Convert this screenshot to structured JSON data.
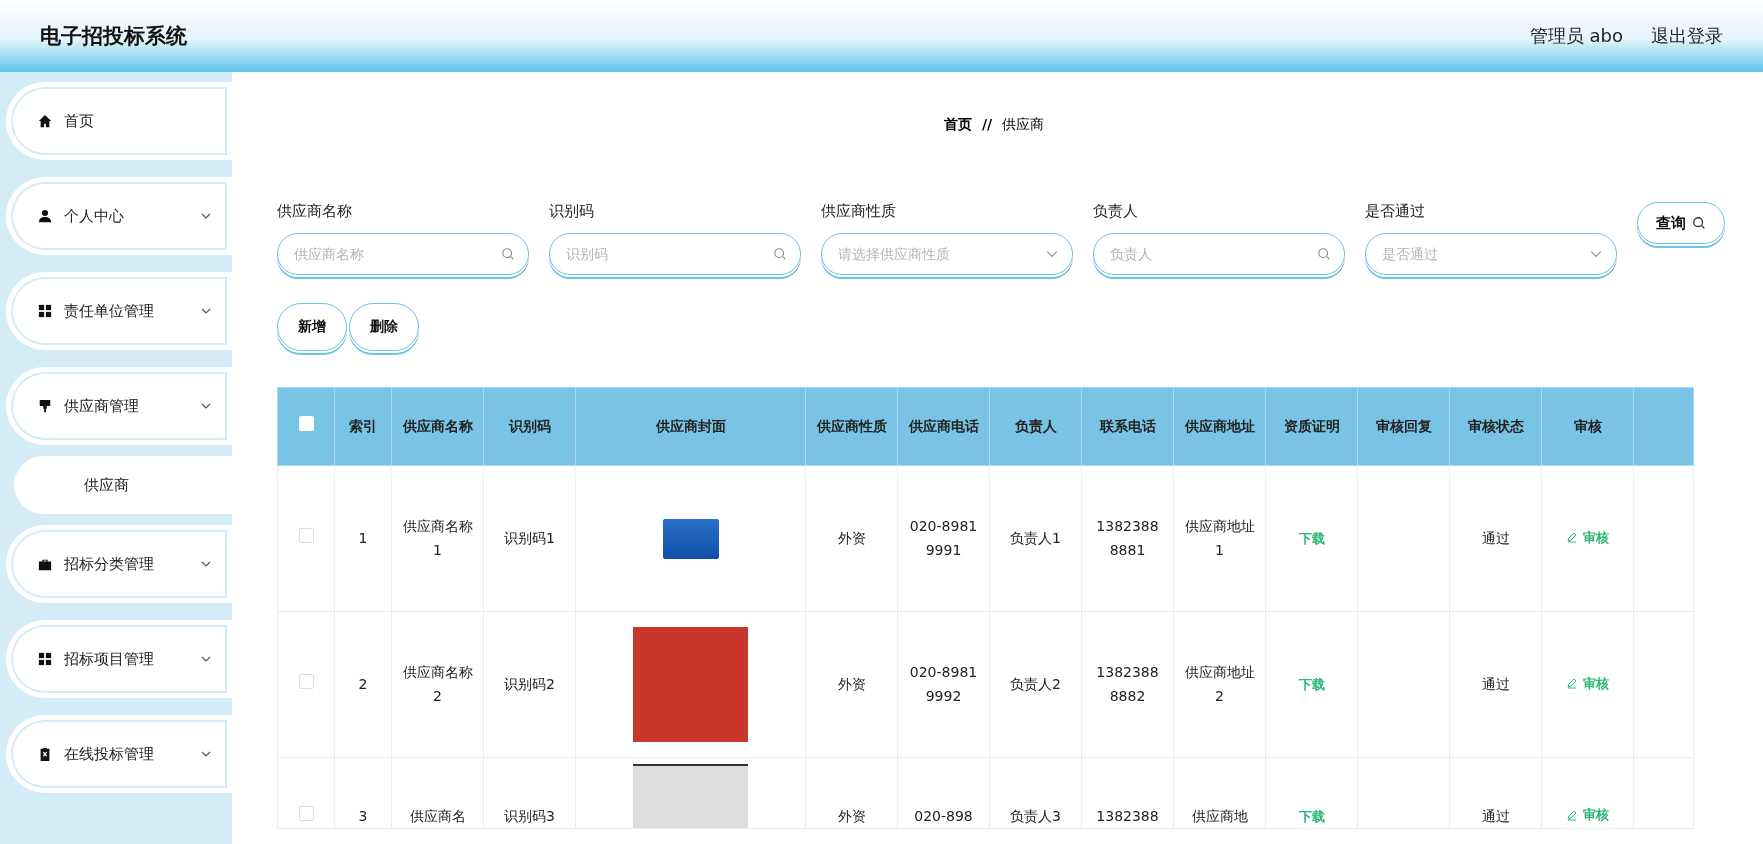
{
  "header": {
    "title": "电子招投标系统",
    "user": "管理员 abo",
    "logout": "退出登录"
  },
  "sidebar": {
    "items": [
      {
        "label": "首页",
        "kind": "link"
      },
      {
        "label": "个人中心",
        "kind": "group"
      },
      {
        "label": "责任单位管理",
        "kind": "group"
      },
      {
        "label": "供应商管理",
        "kind": "group",
        "children": [
          {
            "label": "供应商"
          }
        ]
      },
      {
        "label": "招标分类管理",
        "kind": "group"
      },
      {
        "label": "招标项目管理",
        "kind": "group"
      },
      {
        "label": "在线投标管理",
        "kind": "group"
      }
    ]
  },
  "breadcrumb": [
    "首页",
    "//",
    "供应商"
  ],
  "filters": [
    {
      "label": "供应商名称",
      "placeholder": "供应商名称",
      "kind": "search"
    },
    {
      "label": "识别码",
      "placeholder": "识别码",
      "kind": "search"
    },
    {
      "label": "供应商性质",
      "placeholder": "请选择供应商性质",
      "kind": "select"
    },
    {
      "label": "负责人",
      "placeholder": "负责人",
      "kind": "search"
    },
    {
      "label": "是否通过",
      "placeholder": "是否通过",
      "kind": "select"
    }
  ],
  "query_button": "查询",
  "actions": [
    "新增",
    "删除"
  ],
  "table": {
    "all_checked": false,
    "columns": [
      "索引",
      "供应商名称",
      "识别码",
      "供应商封面",
      "供应商性质",
      "供应商电话",
      "负责人",
      "联系电话",
      "供应商地址",
      "资质证明",
      "审核回复",
      "审核状态",
      "审核"
    ],
    "rows": [
      {
        "checked": false,
        "index": "1",
        "name": "供应商名称1",
        "code": "识别码1",
        "cover": {
          "kind": "logo"
        },
        "nature": "外资",
        "phone": "020-89819991",
        "person": "负责人1",
        "contact": "13823888881",
        "address": "供应商地址1",
        "qualification": "下载",
        "status": "通过",
        "action": "审核"
      },
      {
        "checked": false,
        "index": "2",
        "name": "供应商名称2",
        "code": "识别码2",
        "cover": {
          "kind": "photo"
        },
        "nature": "外资",
        "phone": "020-89819992",
        "person": "负责人2",
        "contact": "13823888882",
        "address": "供应商地址2",
        "qualification": "下载",
        "status": "通过",
        "action": "审核"
      },
      {
        "checked": false,
        "index": "3",
        "name": "供应商名",
        "code": "识别码3",
        "cover": {
          "kind": "photo"
        },
        "nature": "外资",
        "phone": "020-898",
        "person": "负责人3",
        "contact": "1382388",
        "address": "供应商地",
        "qualification": "下载",
        "status": "通过",
        "action": "审核"
      }
    ]
  }
}
